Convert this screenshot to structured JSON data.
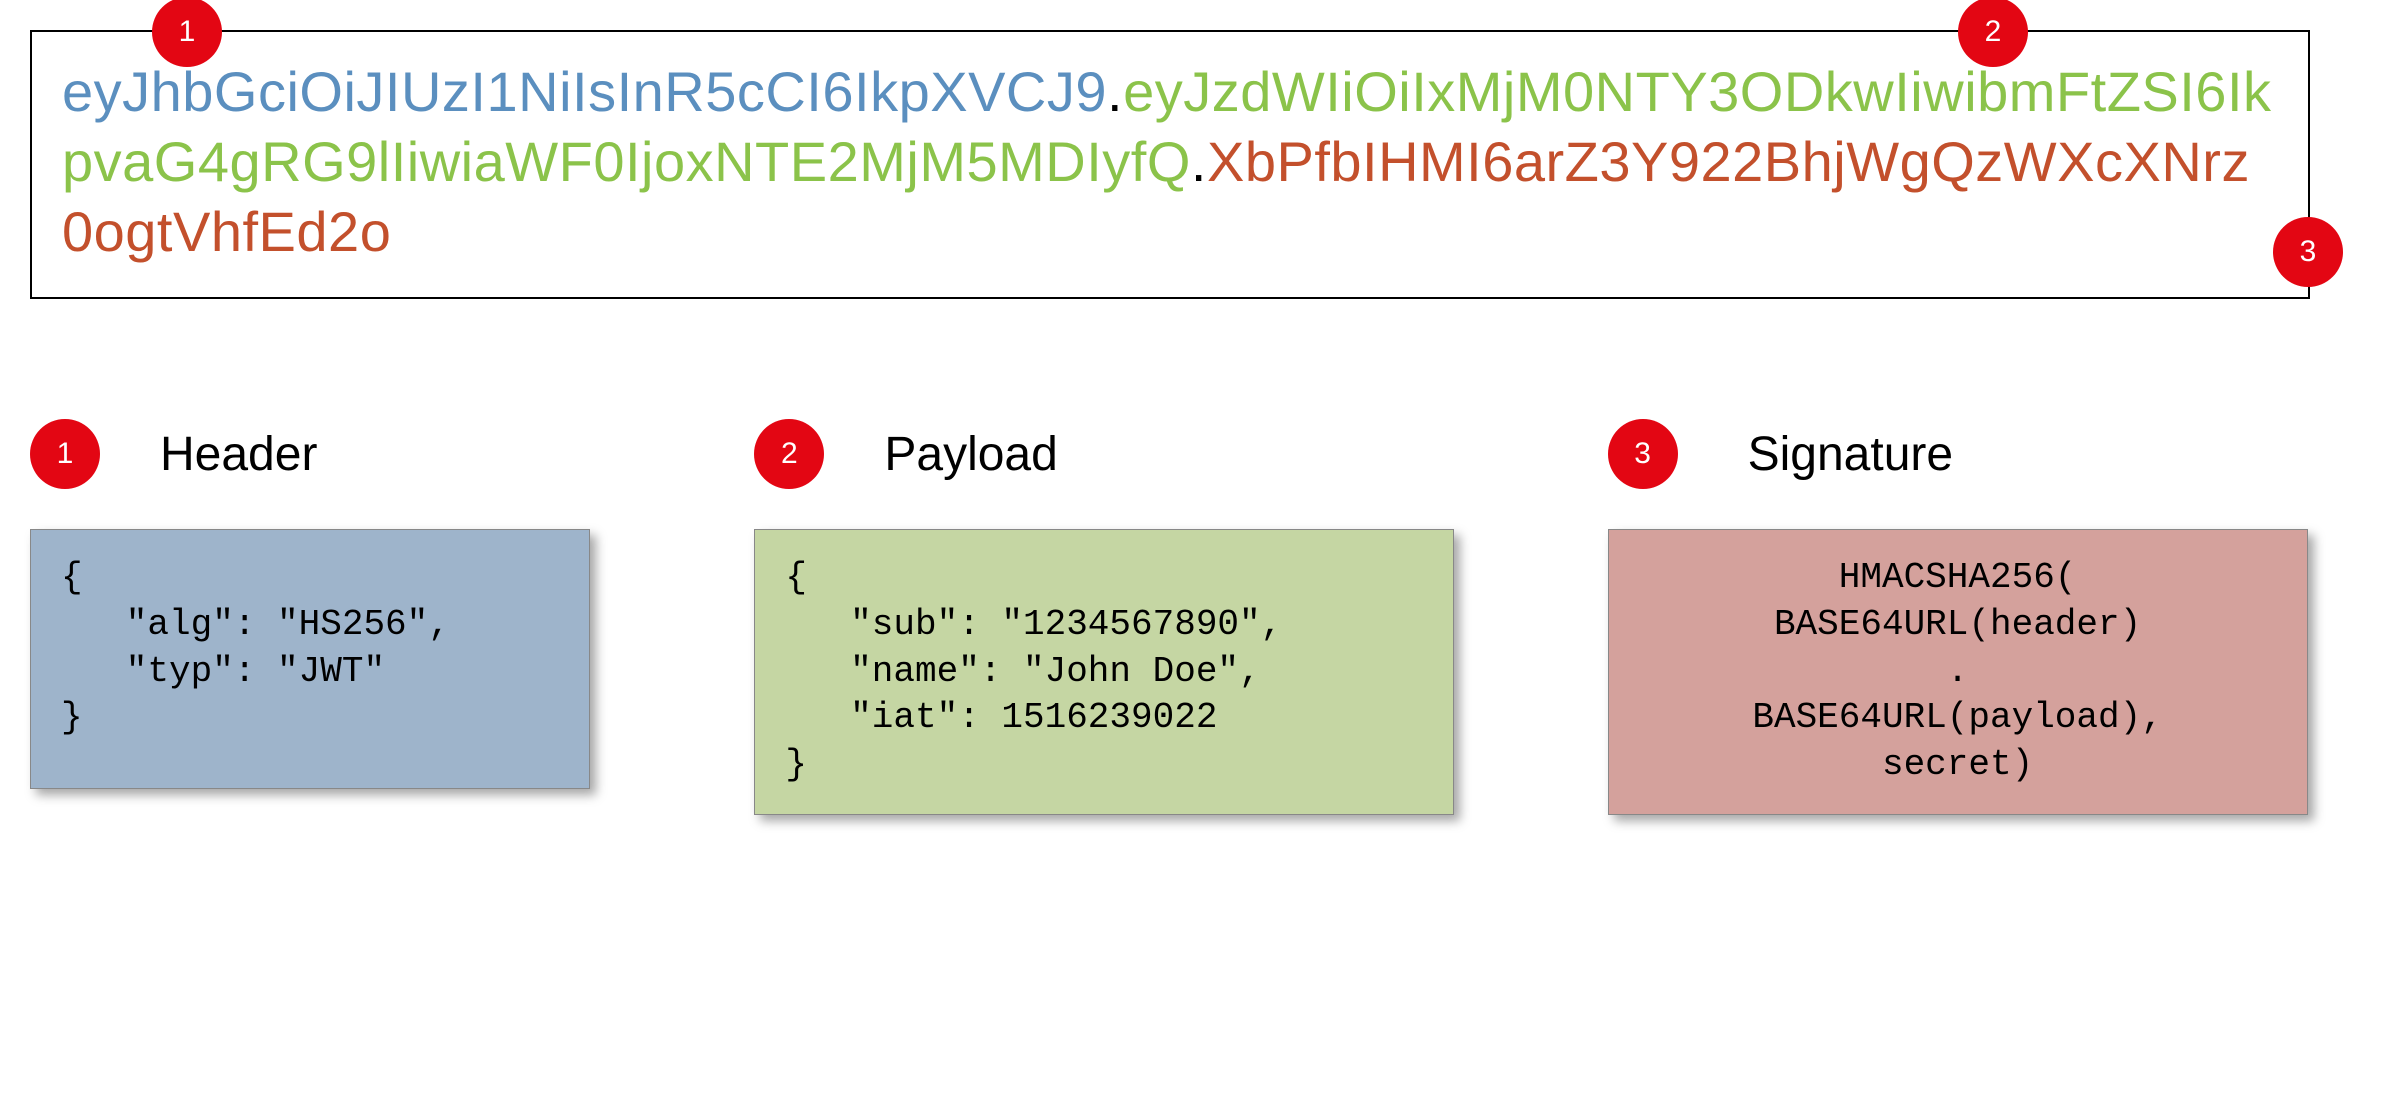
{
  "token": {
    "header_segment": "eyJhbGciOiJIUzI1NiIsInR5cCI6IkpXVCJ9",
    "payload_segment": "eyJzdWIiOiIxMjM0NTY3ODkwIiwibmFtZSI6IkpvaG4gRG9lIiwiaWF0IjoxNTE2MjM5MDIyfQ",
    "signature_segment": "XbPfbIHMI6arZ3Y922BhjWgQzWXcXNrz0ogtVhfEd2o",
    "dot": "."
  },
  "badges": {
    "one": "1",
    "two": "2",
    "three": "3"
  },
  "sections": {
    "header": {
      "title": "Header",
      "code": "{\n   \"alg\": \"HS256\",\n   \"typ\": \"JWT\"\n}"
    },
    "payload": {
      "title": "Payload",
      "code": "{\n   \"sub\": \"1234567890\",\n   \"name\": \"John Doe\",\n   \"iat\": 1516239022\n}"
    },
    "signature": {
      "title": "Signature",
      "code": "HMACSHA256(\nBASE64URL(header)\n.\nBASE64URL(payload),\nsecret)"
    }
  },
  "colors": {
    "header": "#5b8fbf",
    "payload": "#8bc34a",
    "signature": "#c3502c",
    "badge_bg": "#e30613",
    "box_header_bg": "#9eb4cb",
    "box_payload_bg": "#c5d6a3",
    "box_signature_bg": "#d4a19c"
  }
}
